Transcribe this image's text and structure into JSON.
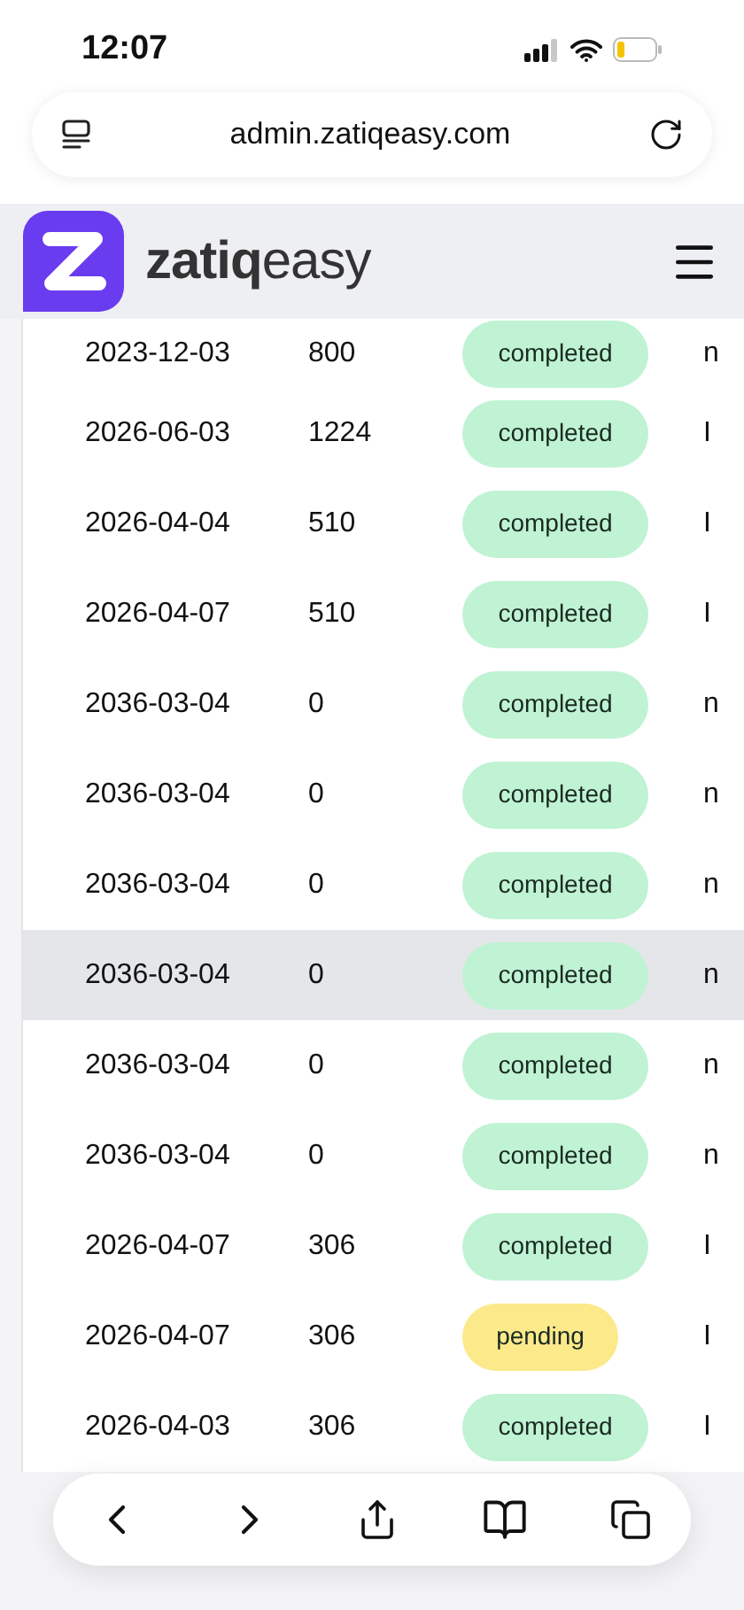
{
  "status_bar": {
    "time": "12:07"
  },
  "address_bar": {
    "url": "admin.zatiqeasy.com"
  },
  "header": {
    "logo_text": "**zatiq**easy"
  },
  "table": {
    "rows": [
      {
        "date": "2023-12-03",
        "amount": "800",
        "status": {
          "label": "completed",
          "kind": "completed"
        },
        "column_4": "n",
        "highlighted": false
      },
      {
        "date": "2026-06-03",
        "amount": "1224",
        "status": {
          "label": "completed",
          "kind": "completed"
        },
        "column_4": "I",
        "highlighted": false
      },
      {
        "date": "2026-04-04",
        "amount": "510",
        "status": {
          "label": "completed",
          "kind": "completed"
        },
        "column_4": "I",
        "highlighted": false
      },
      {
        "date": "2026-04-07",
        "amount": "510",
        "status": {
          "label": "completed",
          "kind": "completed"
        },
        "column_4": "I",
        "highlighted": false
      },
      {
        "date": "2036-03-04",
        "amount": "0",
        "status": {
          "label": "completed",
          "kind": "completed"
        },
        "column_4": "n",
        "highlighted": false
      },
      {
        "date": "2036-03-04",
        "amount": "0",
        "status": {
          "label": "completed",
          "kind": "completed"
        },
        "column_4": "n",
        "highlighted": false
      },
      {
        "date": "2036-03-04",
        "amount": "0",
        "status": {
          "label": "completed",
          "kind": "completed"
        },
        "column_4": "n",
        "highlighted": false
      },
      {
        "date": "2036-03-04",
        "amount": "0",
        "status": {
          "label": "completed",
          "kind": "completed"
        },
        "column_4": "n",
        "highlighted": true
      },
      {
        "date": "2036-03-04",
        "amount": "0",
        "status": {
          "label": "completed",
          "kind": "completed"
        },
        "column_4": "n",
        "highlighted": false
      },
      {
        "date": "2036-03-04",
        "amount": "0",
        "status": {
          "label": "completed",
          "kind": "completed"
        },
        "column_4": "n",
        "highlighted": false
      },
      {
        "date": "2026-04-07",
        "amount": "306",
        "status": {
          "label": "completed",
          "kind": "completed"
        },
        "column_4": "I",
        "highlighted": false
      },
      {
        "date": "2026-04-07",
        "amount": "306",
        "status": {
          "label": "pending",
          "kind": "pending"
        },
        "column_4": "I",
        "highlighted": false
      },
      {
        "date": "2026-04-03",
        "amount": "306",
        "status": {
          "label": "completed",
          "kind": "completed"
        },
        "column_4": "I",
        "highlighted": false
      }
    ]
  }
}
